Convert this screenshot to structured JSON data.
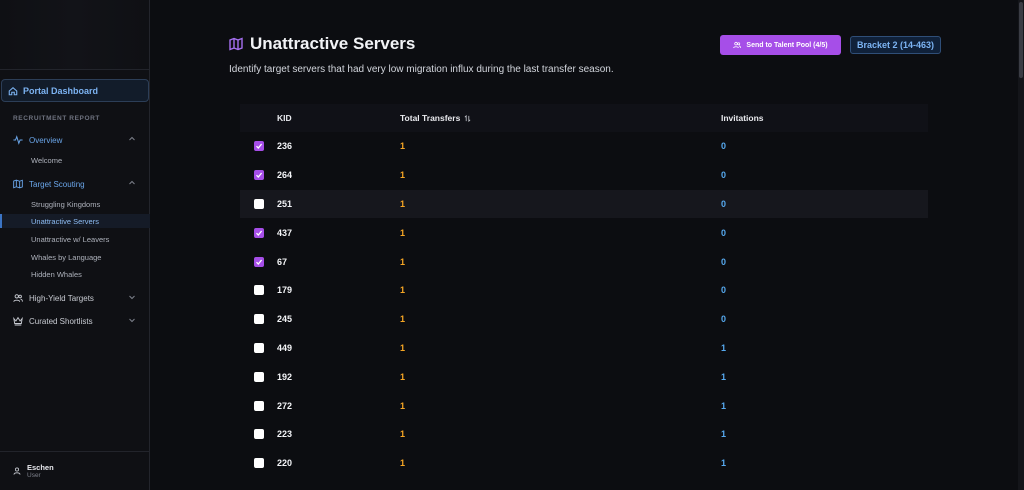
{
  "sidebar": {
    "dashboard_label": "Portal Dashboard",
    "section_label": "RECRUITMENT REPORT",
    "overview": {
      "label": "Overview",
      "items": [
        "Welcome"
      ]
    },
    "target_scouting": {
      "label": "Target Scouting",
      "items": [
        "Struggling Kingdoms",
        "Unattractive Servers",
        "Unattractive w/ Leavers",
        "Whales by Language",
        "Hidden Whales"
      ],
      "active_index": 1
    },
    "high_yield": {
      "label": "High-Yield Targets"
    },
    "shortlists": {
      "label": "Curated Shortlists"
    },
    "user": {
      "name": "Eschen",
      "role": "User"
    }
  },
  "header": {
    "title": "Unattractive Servers",
    "subtitle": "Identify target servers that had very low migration influx during the last transfer season.",
    "send_button": "Send to Talent Pool (4/5)",
    "bracket": "Bracket 2 (14-463)"
  },
  "table": {
    "columns": {
      "kid": "KID",
      "total": "Total Transfers",
      "invitations": "Invitations"
    },
    "rows": [
      {
        "checked": true,
        "kid": "236",
        "total": "1",
        "inv": "0"
      },
      {
        "checked": true,
        "kid": "264",
        "total": "1",
        "inv": "0"
      },
      {
        "checked": false,
        "kid": "251",
        "total": "1",
        "inv": "0"
      },
      {
        "checked": true,
        "kid": "437",
        "total": "1",
        "inv": "0"
      },
      {
        "checked": true,
        "kid": "67",
        "total": "1",
        "inv": "0"
      },
      {
        "checked": false,
        "kid": "179",
        "total": "1",
        "inv": "0"
      },
      {
        "checked": false,
        "kid": "245",
        "total": "1",
        "inv": "0"
      },
      {
        "checked": false,
        "kid": "449",
        "total": "1",
        "inv": "1"
      },
      {
        "checked": false,
        "kid": "192",
        "total": "1",
        "inv": "1"
      },
      {
        "checked": false,
        "kid": "272",
        "total": "1",
        "inv": "1"
      },
      {
        "checked": false,
        "kid": "223",
        "total": "1",
        "inv": "1"
      },
      {
        "checked": false,
        "kid": "220",
        "total": "1",
        "inv": "1"
      }
    ]
  },
  "colors": {
    "accent": "#a64ee8",
    "transfers": "#f5a524",
    "invitations": "#56a9ef",
    "link": "#6aa6ea"
  }
}
